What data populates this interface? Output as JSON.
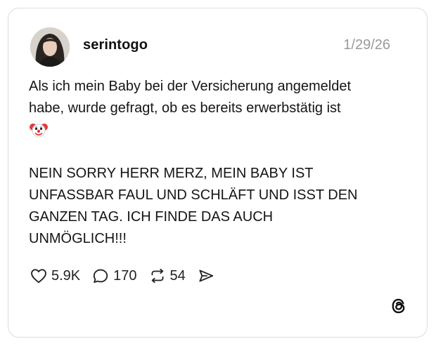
{
  "post": {
    "username": "serintogo",
    "date": "1/29/26",
    "text_line_1": "Als ich mein Baby bei der Versicherung angemeldet",
    "text_line_2": "habe, wurde gefragt, ob es bereits erwerbstätig ist",
    "emoji_icon": "clown-face-icon",
    "text_caps_1": "NEIN SORRY HERR MERZ, MEIN BABY IST",
    "text_caps_2": "UNFASSBAR FAUL UND SCHLÄFT UND ISST DEN",
    "text_caps_3": "GANZEN TAG. ICH FINDE DAS AUCH",
    "text_caps_4": "UNMÖGLICH!!!"
  },
  "actions": {
    "likes": "5.9K",
    "replies": "170",
    "reposts": "54",
    "like_icon": "heart-icon",
    "reply_icon": "speech-bubble-icon",
    "repost_icon": "repost-icon",
    "share_icon": "send-icon"
  },
  "branding": {
    "logo_icon": "threads-logo-icon"
  },
  "colors": {
    "text": "#111111",
    "date": "#9a9a9a",
    "border": "#dcdcdc",
    "clown_red": "#e63a3a"
  }
}
